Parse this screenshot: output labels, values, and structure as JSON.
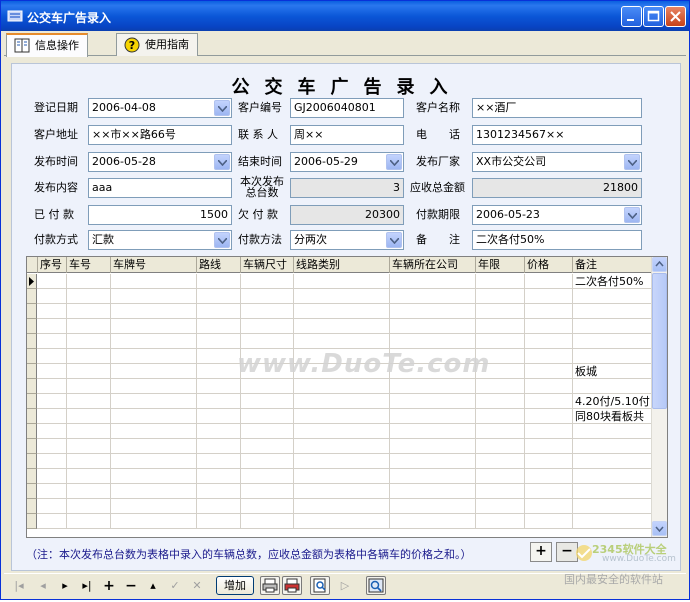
{
  "window": {
    "title": "公交车广告录入",
    "title_icon": "app-icon"
  },
  "tabs": [
    {
      "label": "信息操作",
      "icon": "info-book-icon",
      "active": true
    },
    {
      "label": "使用指南",
      "icon": "help-icon",
      "active": false
    }
  ],
  "form": {
    "title": "公交车广告录入",
    "labels": {
      "reg_date": "登记日期",
      "cust_no": "客户编号",
      "cust_name": "客户名称",
      "cust_addr": "客户地址",
      "contact": "联 系 人",
      "phone": "电　　话",
      "pub_time": "发布时间",
      "end_time": "结束时间",
      "pub_maker": "发布厂家",
      "pub_content": "发布内容",
      "total_count_1": "本次发布",
      "total_count_2": "总台数",
      "receivable": "应收总金额",
      "paid": "已 付 款",
      "owed": "欠 付 款",
      "pay_deadline": "付款期限",
      "pay_way": "付款方式",
      "pay_method": "付款方法",
      "remark": "备　　注"
    },
    "values": {
      "reg_date": "2006-04-08",
      "cust_no": "GJ2006040801",
      "cust_name": "××酒厂",
      "cust_addr": "××市××路66号",
      "contact": "周××",
      "phone": "1301234567××",
      "pub_time": "2006-05-28",
      "end_time": "2006-05-29",
      "pub_maker": "XX市公交公司",
      "pub_content": "aaa",
      "total_count": "3",
      "receivable": "21800",
      "paid": "1500",
      "owed": "20300",
      "pay_deadline": "2006-05-23",
      "pay_way": "汇款",
      "pay_method": "分两次",
      "remark": "二次各付50%"
    }
  },
  "grid": {
    "columns": [
      "序号",
      "车号",
      "车牌号",
      "路线",
      "车辆尺寸",
      "线路类别",
      "车辆所在公司",
      "年限",
      "价格",
      "备注"
    ],
    "remarks": [
      "二次各付50%",
      "",
      "",
      "",
      "",
      "",
      "板城",
      "",
      "4.20付/5.10付",
      "同80块看板共"
    ]
  },
  "note": "（注：本次发布总台数为表格中录入的车辆总数，应收总金额为表格中各辆车的价格之和。）",
  "buttons": {
    "add_row": "+",
    "remove_row": "−",
    "add": "增加"
  },
  "watermarks": {
    "site": "www.DuoTe.com",
    "logo_line1": "2345软件大全",
    "logo_line2": "国内最安全的软件站",
    "logo_url": "www.DuoTe.com"
  },
  "colors": {
    "titlebar": "#0b57d8",
    "panel_bg": "#eef2fb",
    "note_text": "#1a1a8c",
    "active_tab_accent": "#e68b2c"
  }
}
